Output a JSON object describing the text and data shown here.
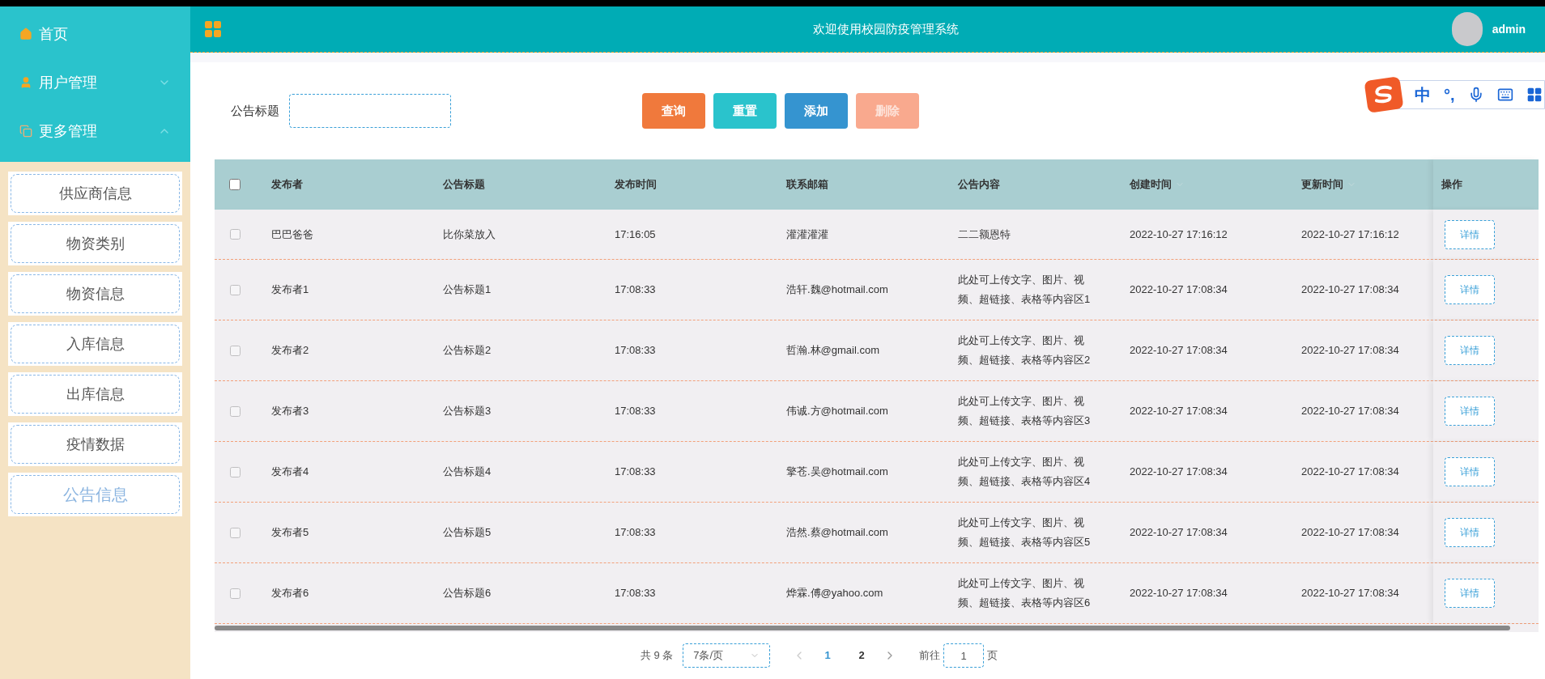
{
  "sidebar": {
    "menus": [
      {
        "label": "首页"
      },
      {
        "label": "用户管理",
        "expanded": false
      },
      {
        "label": "更多管理",
        "expanded": true
      }
    ],
    "submenu": [
      {
        "label": "供应商信息",
        "selected": false
      },
      {
        "label": "物资类别",
        "selected": false
      },
      {
        "label": "物资信息",
        "selected": false
      },
      {
        "label": "入库信息",
        "selected": false
      },
      {
        "label": "出库信息",
        "selected": false
      },
      {
        "label": "疫情数据",
        "selected": false
      },
      {
        "label": "公告信息",
        "selected": true
      }
    ]
  },
  "header": {
    "title": "欢迎使用校园防疫管理系统",
    "user": "admin"
  },
  "ime_toolbar": {
    "labels": [
      "中",
      "°,"
    ]
  },
  "search": {
    "label": "公告标题"
  },
  "buttons": [
    {
      "label": "查询",
      "color": "#f0793c",
      "disabled": false
    },
    {
      "label": "重置",
      "color": "#2ac3cc",
      "disabled": false
    },
    {
      "label": "添加",
      "color": "#3594d0",
      "disabled": false
    },
    {
      "label": "删除",
      "color": "#f9a98e",
      "disabled": true
    }
  ],
  "table": {
    "columns": [
      {
        "label": "发布者"
      },
      {
        "label": "公告标题"
      },
      {
        "label": "发布时间"
      },
      {
        "label": "联系邮箱"
      },
      {
        "label": "公告内容"
      },
      {
        "label": "创建时间",
        "sortable": true
      },
      {
        "label": "更新时间",
        "sortable": true
      },
      {
        "label": "操作"
      }
    ],
    "all_checked": false,
    "rows": [
      {
        "checked": false,
        "cells": [
          "巴巴爸爸",
          "比你菜放入",
          "17:16:05",
          "灌灌灌灌",
          "二二额恩特",
          "2022-10-27 17:16:12",
          "2022-10-27 17:16:12"
        ],
        "action": "详情"
      },
      {
        "checked": false,
        "cells": [
          "发布者1",
          "公告标题1",
          "17:08:33",
          "浩轩.魏@hotmail.com",
          "此处可上传文字、图片、视频、超链接、表格等内容区1",
          "2022-10-27 17:08:34",
          "2022-10-27 17:08:34"
        ],
        "action": "详情"
      },
      {
        "checked": false,
        "cells": [
          "发布者2",
          "公告标题2",
          "17:08:33",
          "哲瀚.林@gmail.com",
          "此处可上传文字、图片、视频、超链接、表格等内容区2",
          "2022-10-27 17:08:34",
          "2022-10-27 17:08:34"
        ],
        "action": "详情"
      },
      {
        "checked": false,
        "cells": [
          "发布者3",
          "公告标题3",
          "17:08:33",
          "伟诚.方@hotmail.com",
          "此处可上传文字、图片、视频、超链接、表格等内容区3",
          "2022-10-27 17:08:34",
          "2022-10-27 17:08:34"
        ],
        "action": "详情"
      },
      {
        "checked": false,
        "cells": [
          "发布者4",
          "公告标题4",
          "17:08:33",
          "擎苍.吴@hotmail.com",
          "此处可上传文字、图片、视频、超链接、表格等内容区4",
          "2022-10-27 17:08:34",
          "2022-10-27 17:08:34"
        ],
        "action": "详情"
      },
      {
        "checked": false,
        "cells": [
          "发布者5",
          "公告标题5",
          "17:08:33",
          "浩然.蔡@hotmail.com",
          "此处可上传文字、图片、视频、超链接、表格等内容区5",
          "2022-10-27 17:08:34",
          "2022-10-27 17:08:34"
        ],
        "action": "详情"
      },
      {
        "checked": false,
        "cells": [
          "发布者6",
          "公告标题6",
          "17:08:33",
          "烨霖.傅@yahoo.com",
          "此处可上传文字、图片、视频、超链接、表格等内容区6",
          "2022-10-27 17:08:34",
          "2022-10-27 17:08:34"
        ],
        "action": "详情"
      }
    ]
  },
  "pagination": {
    "total": "共 9 条",
    "page_size": "7条/页",
    "pages": [
      {
        "label": "1",
        "selected": true
      },
      {
        "label": "2",
        "selected": false
      }
    ],
    "goto_label": "前往",
    "goto_value": "1",
    "unit": "页"
  }
}
